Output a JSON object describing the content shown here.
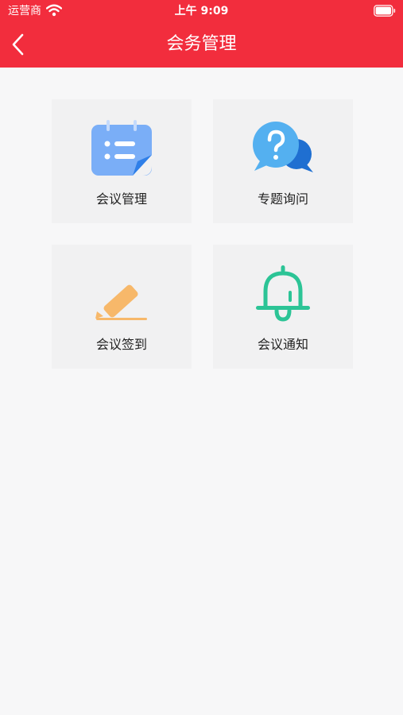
{
  "status_bar": {
    "carrier": "运营商",
    "time": "上午 9:09"
  },
  "nav": {
    "title": "会务管理",
    "back_icon": "chevron-left-icon"
  },
  "tiles": [
    {
      "label": "会议管理",
      "icon": "calendar-list-icon",
      "color": "#7aaef7"
    },
    {
      "label": "专题询问",
      "icon": "question-chat-icon",
      "color": "#4fa8ee"
    },
    {
      "label": "会议签到",
      "icon": "pencil-icon",
      "color": "#f7b86a"
    },
    {
      "label": "会议通知",
      "icon": "bell-icon",
      "color": "#2cc496"
    }
  ],
  "colors": {
    "header": "#f22d3d",
    "background": "#f7f7f8",
    "tile": "#f1f1f2"
  }
}
